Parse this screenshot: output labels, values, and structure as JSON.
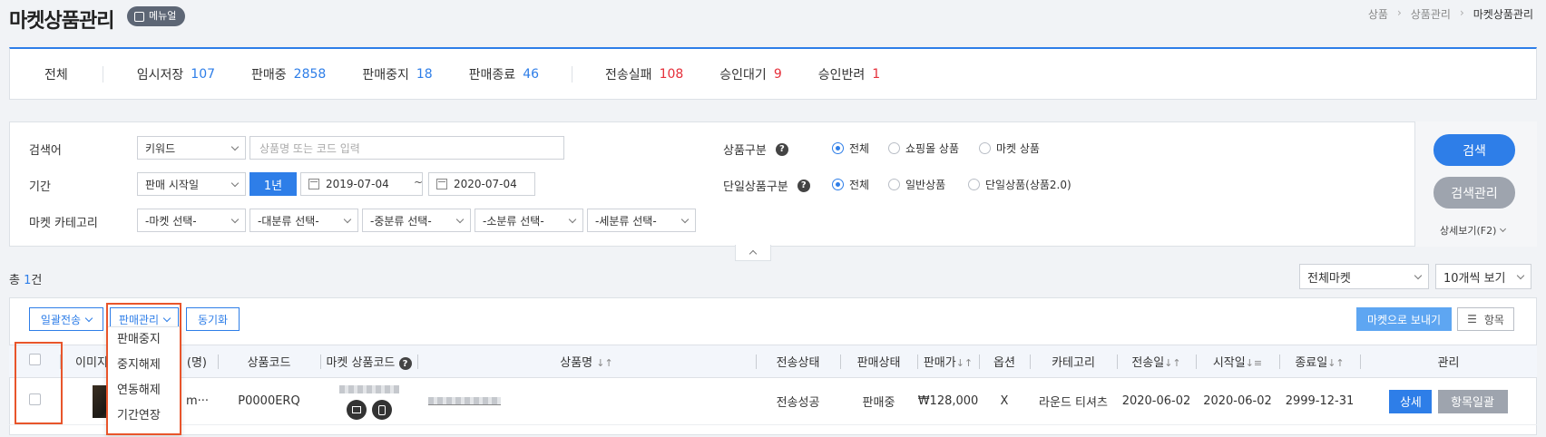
{
  "header": {
    "title": "마켓상품관리",
    "menu_badge": "메뉴얼",
    "breadcrumb": [
      "상품",
      "상품관리",
      "마켓상품관리"
    ]
  },
  "status_bar": {
    "all": "전체",
    "items": [
      {
        "label": "임시저장",
        "count": "107"
      },
      {
        "label": "판매중",
        "count": "2858"
      },
      {
        "label": "판매중지",
        "count": "18"
      },
      {
        "label": "판매종료",
        "count": "46"
      },
      {
        "label": "전송실패",
        "count": "108"
      },
      {
        "label": "승인대기",
        "count": "9"
      },
      {
        "label": "승인반려",
        "count": "1"
      }
    ]
  },
  "search": {
    "keyword_label": "검색어",
    "keyword_type": "키워드",
    "keyword_placeholder": "상품명 또는 코드 입력",
    "period_label": "기간",
    "period_type": "판매 시작일",
    "period_button": "1년",
    "date_from": "2019-07-04",
    "date_sep": "~",
    "date_to": "2020-07-04",
    "category_label": "마켓 카테고리",
    "categories": [
      "-마켓 선택-",
      "-대분류 선택-",
      "-중분류 선택-",
      "-소분류 선택-",
      "-세분류 선택-"
    ],
    "product_type_label": "상품구분",
    "product_type_options": [
      "전체",
      "쇼핑몰 상품",
      "마켓 상품"
    ],
    "single_type_label": "단일상품구분",
    "single_type_options": [
      "전체",
      "일반상품",
      "단일상품(상품2.0)"
    ],
    "help_glyph": "?",
    "search_button": "검색",
    "manage_button": "검색관리",
    "detail_toggle": "상세보기(F2)"
  },
  "list": {
    "total_prefix": "총",
    "total_count": "1",
    "total_suffix": "건",
    "market_filter": "전체마켓",
    "page_size": "10개씩 보기",
    "toolbar": {
      "bulk_send": "일괄전송",
      "sales_manage": "판매관리",
      "sync": "동기화",
      "send_to_market": "마켓으로 보내기",
      "columns": "항목"
    },
    "sales_menu": [
      "판매중지",
      "중지해제",
      "연동해제",
      "기간연장"
    ],
    "columns": [
      "",
      "이미지",
      "(명)",
      "상품코드",
      "마켓 상품코드",
      "상품명",
      "전송상태",
      "판매상태",
      "판매가",
      "옵션",
      "카테고리",
      "전송일",
      "시작일",
      "종료일",
      "관리"
    ],
    "row": {
      "name_fragment": "m···",
      "product_code": "P0000ERQ",
      "send_status": "전송성공",
      "sale_status": "판매중",
      "price": "₩128,000",
      "option": "X",
      "category": "라운드 티셔츠",
      "sent_date": "2020-06-02",
      "start_date": "2020-06-02",
      "end_date": "2999-12-31",
      "detail_button": "상세",
      "bulk_button": "항목일괄"
    }
  },
  "colors": {
    "accent": "#2e7ee8",
    "count_red": "#e52f3a",
    "highlight": "#e8552b"
  }
}
